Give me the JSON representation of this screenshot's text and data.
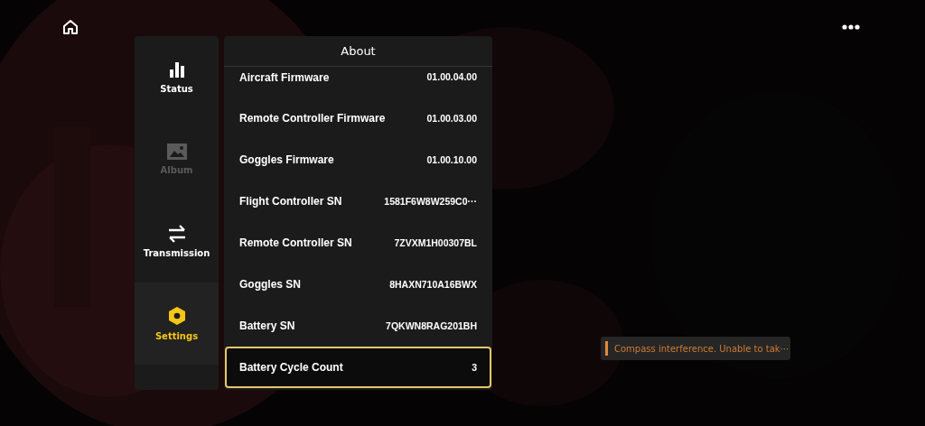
{
  "sidebar": {
    "items": [
      {
        "label": "Status",
        "kind": "status",
        "selected": false,
        "disabled": false
      },
      {
        "label": "Album",
        "kind": "album",
        "selected": false,
        "disabled": true
      },
      {
        "label": "Transmission",
        "kind": "transmission",
        "selected": false,
        "disabled": false
      },
      {
        "label": "Settings",
        "kind": "settings",
        "selected": true,
        "disabled": false
      }
    ]
  },
  "panel": {
    "title": "About",
    "rows": [
      {
        "label": "Aircraft Firmware",
        "value": "01.00.04.00",
        "selected": false
      },
      {
        "label": "Remote Controller Firmware",
        "value": "01.00.03.00",
        "selected": false
      },
      {
        "label": "Goggles Firmware",
        "value": "01.00.10.00",
        "selected": false
      },
      {
        "label": "Flight Controller SN",
        "value": "1581F6W8W259C0···",
        "selected": false
      },
      {
        "label": "Remote Controller SN",
        "value": "7ZVXM1H00307BL",
        "selected": false
      },
      {
        "label": "Goggles SN",
        "value": "8HAXN710A16BWX",
        "selected": false
      },
      {
        "label": "Battery SN",
        "value": "7QKWN8RAG201BH",
        "selected": false
      },
      {
        "label": "Battery Cycle Count",
        "value": "3",
        "selected": true
      }
    ]
  },
  "toast": {
    "message": "Compass interference. Unable to tak···"
  }
}
